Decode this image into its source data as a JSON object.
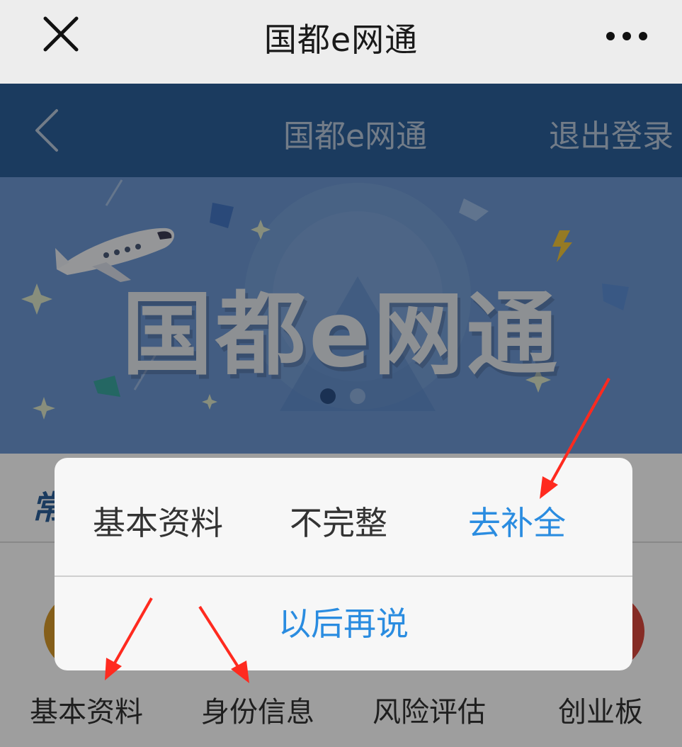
{
  "wechat_bar": {
    "title": "国都e网通",
    "close_icon": "close-icon",
    "more_icon": "more-icon"
  },
  "app_nav": {
    "back_icon": "chevron-left-icon",
    "title": "国都e网通",
    "logout": "退出登录"
  },
  "banner": {
    "text": "国都e网通",
    "slides_total": 2,
    "active_slide": 1
  },
  "section": {
    "title": "常"
  },
  "functions": [
    {
      "label": "基本资料",
      "color": "#d79a2a"
    },
    {
      "label": "身份信息",
      "color": "#3d7fd6"
    },
    {
      "label": "风险评估",
      "color": "#3d7fd6"
    },
    {
      "label": "创业板",
      "color": "#d9473d"
    }
  ],
  "dialog": {
    "item_label": "基本资料",
    "item_status": "不完整",
    "action": "去补全",
    "later": "以后再说"
  },
  "colors": {
    "nav_bg": "#2d5f9a",
    "accent_blue": "#2a8ce0",
    "annotation_red": "#ff2a1f"
  }
}
